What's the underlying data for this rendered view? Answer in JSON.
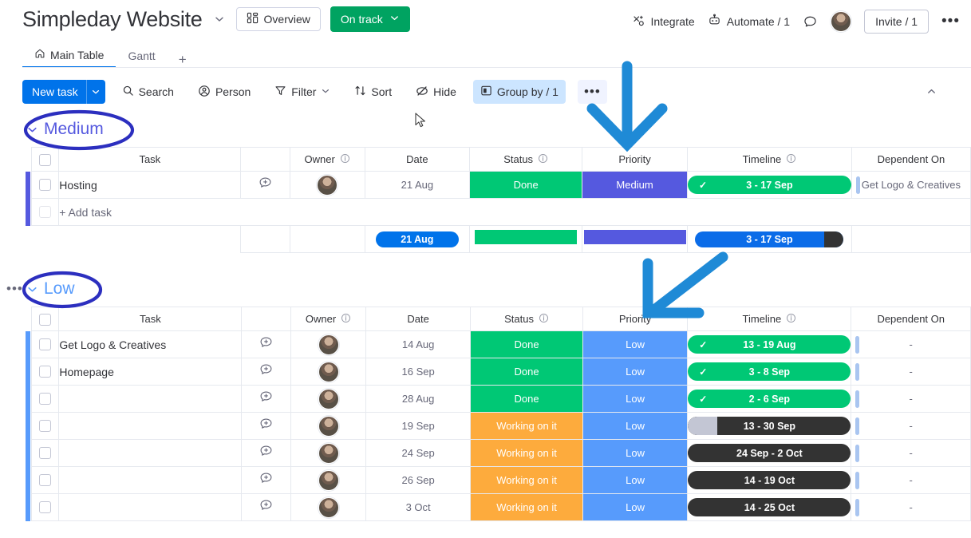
{
  "header": {
    "title": "Simpleday Website",
    "title_chevron_icon": "chevron-down-icon",
    "overview_label": "Overview",
    "overview_icon": "dashboard-icon",
    "status_label": "On track",
    "status_chevron_icon": "chevron-down-icon",
    "status_color": "#00a361",
    "integrate_label": "Integrate",
    "integrate_icon": "integrate-icon",
    "automate_label": "Automate / 1",
    "automate_icon": "robot-icon",
    "chat_icon": "chat-bubble-icon",
    "avatar_icon": "user-avatar",
    "invite_label": "Invite / 1",
    "more_label": "•••"
  },
  "tabs": [
    {
      "label": "Main Table",
      "icon": "home-icon",
      "active": true
    },
    {
      "label": "Gantt",
      "icon": "",
      "active": false
    }
  ],
  "tabs_add_label": "+",
  "toolbar": {
    "new_task_label": "New task",
    "new_task_chevron_icon": "chevron-down-icon",
    "new_task_color": "#0073ea",
    "items": [
      {
        "label": "Search",
        "icon": "search-icon",
        "chevron": false,
        "highlight": false
      },
      {
        "label": "Person",
        "icon": "person-icon",
        "chevron": false,
        "highlight": false
      },
      {
        "label": "Filter",
        "icon": "filter-icon",
        "chevron": true,
        "highlight": false
      },
      {
        "label": "Sort",
        "icon": "sort-icon",
        "chevron": false,
        "highlight": false
      },
      {
        "label": "Hide",
        "icon": "hide-eye-icon",
        "chevron": false,
        "highlight": false
      },
      {
        "label": "Group by / 1",
        "icon": "group-by-icon",
        "chevron": false,
        "highlight": true
      }
    ],
    "more_label": "•••",
    "collapse_icon": "chevron-up-icon"
  },
  "columns": {
    "task": "Task",
    "owner": "Owner",
    "date": "Date",
    "status": "Status",
    "priority": "Priority",
    "timeline": "Timeline",
    "dependent_on": "Dependent On",
    "info_icon": "info-icon"
  },
  "colors": {
    "done": "#00c875",
    "working_on_it": "#fdab3d",
    "priority_medium": "#5559df",
    "priority_low": "#579bfc",
    "timeline_done": "#00c875",
    "timeline_dark": "#333333",
    "timeline_progress": "#c3c6d4",
    "accent_medium": "#5559df",
    "accent_low": "#579bfc",
    "summary_blue": "#0073ea",
    "annotation_circle": "#2c2fbf",
    "annotation_arrow": "#1f8ad6"
  },
  "groups": [
    {
      "name": "Medium",
      "color": "#5559df",
      "collapse_icon": "chevron-down-icon",
      "rows": [
        {
          "task": "Hosting",
          "chat_icon": "chat-add-icon",
          "owner_icon": "user-avatar",
          "date": "21 Aug",
          "status": "Done",
          "status_color": "#00c875",
          "priority": "Medium",
          "priority_color": "#5559df",
          "timeline": "3 - 17 Sep",
          "timeline_color": "#00c875",
          "timeline_done": true,
          "timeline_progress_pct": 0,
          "timeline_check_icon": "check-icon",
          "dependent_on": "Get Logo & Creatives"
        }
      ],
      "add_task_label": "+ Add task",
      "summary": {
        "date_pill": "21 Aug",
        "status_bar_color": "#00c875",
        "priority_bar_color": "#5559df",
        "timeline_pill": "3 - 17 Sep"
      }
    },
    {
      "name": "Low",
      "color": "#579bfc",
      "collapse_icon": "chevron-down-icon",
      "menu_label": "•••",
      "rows": [
        {
          "task": "Get Logo & Creatives",
          "chat_icon": "chat-add-icon",
          "owner_icon": "user-avatar",
          "date": "14 Aug",
          "status": "Done",
          "status_color": "#00c875",
          "priority": "Low",
          "priority_color": "#579bfc",
          "timeline": "13 - 19 Aug",
          "timeline_color": "#00c875",
          "timeline_done": true,
          "timeline_progress_pct": 0,
          "timeline_check_icon": "check-icon",
          "dependent_on": "-"
        },
        {
          "task": "Homepage",
          "chat_icon": "chat-add-icon",
          "owner_icon": "user-avatar",
          "date": "16 Sep",
          "status": "Done",
          "status_color": "#00c875",
          "priority": "Low",
          "priority_color": "#579bfc",
          "timeline": "3 - 8 Sep",
          "timeline_color": "#00c875",
          "timeline_done": true,
          "timeline_progress_pct": 0,
          "timeline_check_icon": "check-icon",
          "dependent_on": "-"
        },
        {
          "task": "",
          "chat_icon": "chat-add-icon",
          "owner_icon": "user-avatar",
          "date": "28 Aug",
          "status": "Done",
          "status_color": "#00c875",
          "priority": "Low",
          "priority_color": "#579bfc",
          "timeline": "2 - 6 Sep",
          "timeline_color": "#00c875",
          "timeline_done": true,
          "timeline_progress_pct": 0,
          "timeline_check_icon": "check-icon",
          "dependent_on": "-"
        },
        {
          "task": "",
          "chat_icon": "chat-add-icon",
          "owner_icon": "user-avatar",
          "date": "19 Sep",
          "status": "Working on it",
          "status_color": "#fdab3d",
          "priority": "Low",
          "priority_color": "#579bfc",
          "timeline": "13 - 30 Sep",
          "timeline_color": "#333333",
          "timeline_done": false,
          "timeline_progress_pct": 18,
          "timeline_check_icon": "",
          "dependent_on": "-"
        },
        {
          "task": "",
          "chat_icon": "chat-add-icon",
          "owner_icon": "user-avatar",
          "date": "24 Sep",
          "status": "Working on it",
          "status_color": "#fdab3d",
          "priority": "Low",
          "priority_color": "#579bfc",
          "timeline": "24 Sep - 2 Oct",
          "timeline_color": "#333333",
          "timeline_done": false,
          "timeline_progress_pct": 0,
          "timeline_check_icon": "",
          "dependent_on": "-"
        },
        {
          "task": "",
          "chat_icon": "chat-add-icon",
          "owner_icon": "user-avatar",
          "date": "26 Sep",
          "status": "Working on it",
          "status_color": "#fdab3d",
          "priority": "Low",
          "priority_color": "#579bfc",
          "timeline": "14 - 19 Oct",
          "timeline_color": "#333333",
          "timeline_done": false,
          "timeline_progress_pct": 0,
          "timeline_check_icon": "",
          "dependent_on": "-"
        },
        {
          "task": "",
          "chat_icon": "chat-add-icon",
          "owner_icon": "user-avatar",
          "date": "3 Oct",
          "status": "Working on it",
          "status_color": "#fdab3d",
          "priority": "Low",
          "priority_color": "#579bfc",
          "timeline": "14 - 25 Oct",
          "timeline_color": "#333333",
          "timeline_done": false,
          "timeline_progress_pct": 0,
          "timeline_check_icon": "",
          "dependent_on": "-"
        }
      ]
    }
  ],
  "annotations": [
    {
      "type": "ellipse",
      "target": "Medium",
      "color": "#2c2fbf"
    },
    {
      "type": "ellipse",
      "target": "Low",
      "color": "#2c2fbf"
    },
    {
      "type": "arrow-down",
      "target": "Priority",
      "color": "#1f8ad6"
    },
    {
      "type": "arrow-diagonal",
      "target": "Priority",
      "color": "#1f8ad6"
    }
  ]
}
